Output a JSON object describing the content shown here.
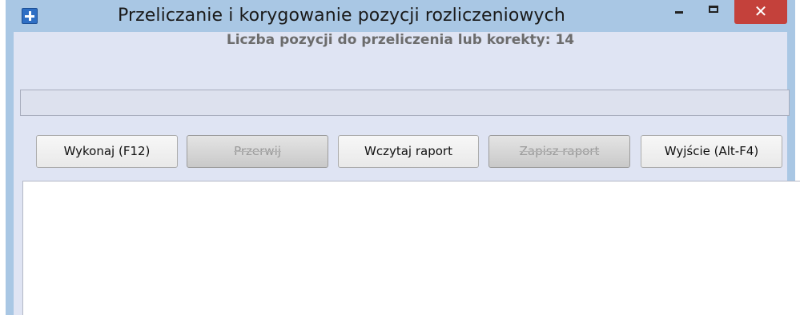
{
  "window": {
    "title": "Przeliczanie i korygowanie pozycji rozliczeniowych",
    "close_glyph": "✕"
  },
  "main": {
    "count_label": "Liczba pozycji do przeliczenia lub korekty: 14",
    "progress": 0
  },
  "buttons": {
    "execute": "Wykonaj (F12)",
    "interrupt": "Przerwij",
    "load_report": "Wczytaj raport",
    "save_report": "Zapisz raport",
    "exit": "Wyjście (Alt-F4)"
  },
  "colors": {
    "frame": "#a9c7e4",
    "content_bg": "#dfe4f3",
    "close_button": "#c4413b"
  },
  "icons": [
    "app-icon",
    "minimize-icon",
    "maximize-icon",
    "close-icon"
  ]
}
